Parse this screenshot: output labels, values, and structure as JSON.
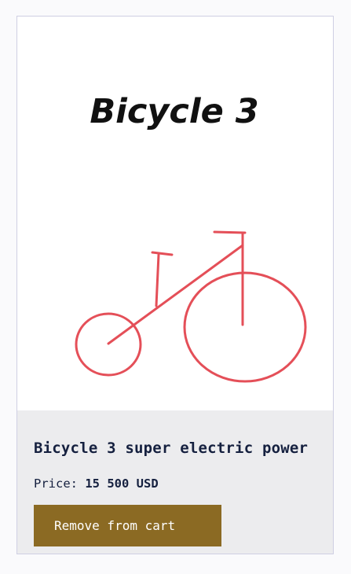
{
  "product": {
    "image_caption": "Bicycle 3",
    "name": "Bicycle 3 super electric power",
    "price_label": "Price:",
    "price_value": "15 500 USD"
  },
  "actions": {
    "remove_label": "Remove from cart"
  },
  "colors": {
    "button_bg": "#8b6a23",
    "info_bg": "#ececee",
    "text": "#15203f",
    "sketch_red": "#e0313c"
  }
}
